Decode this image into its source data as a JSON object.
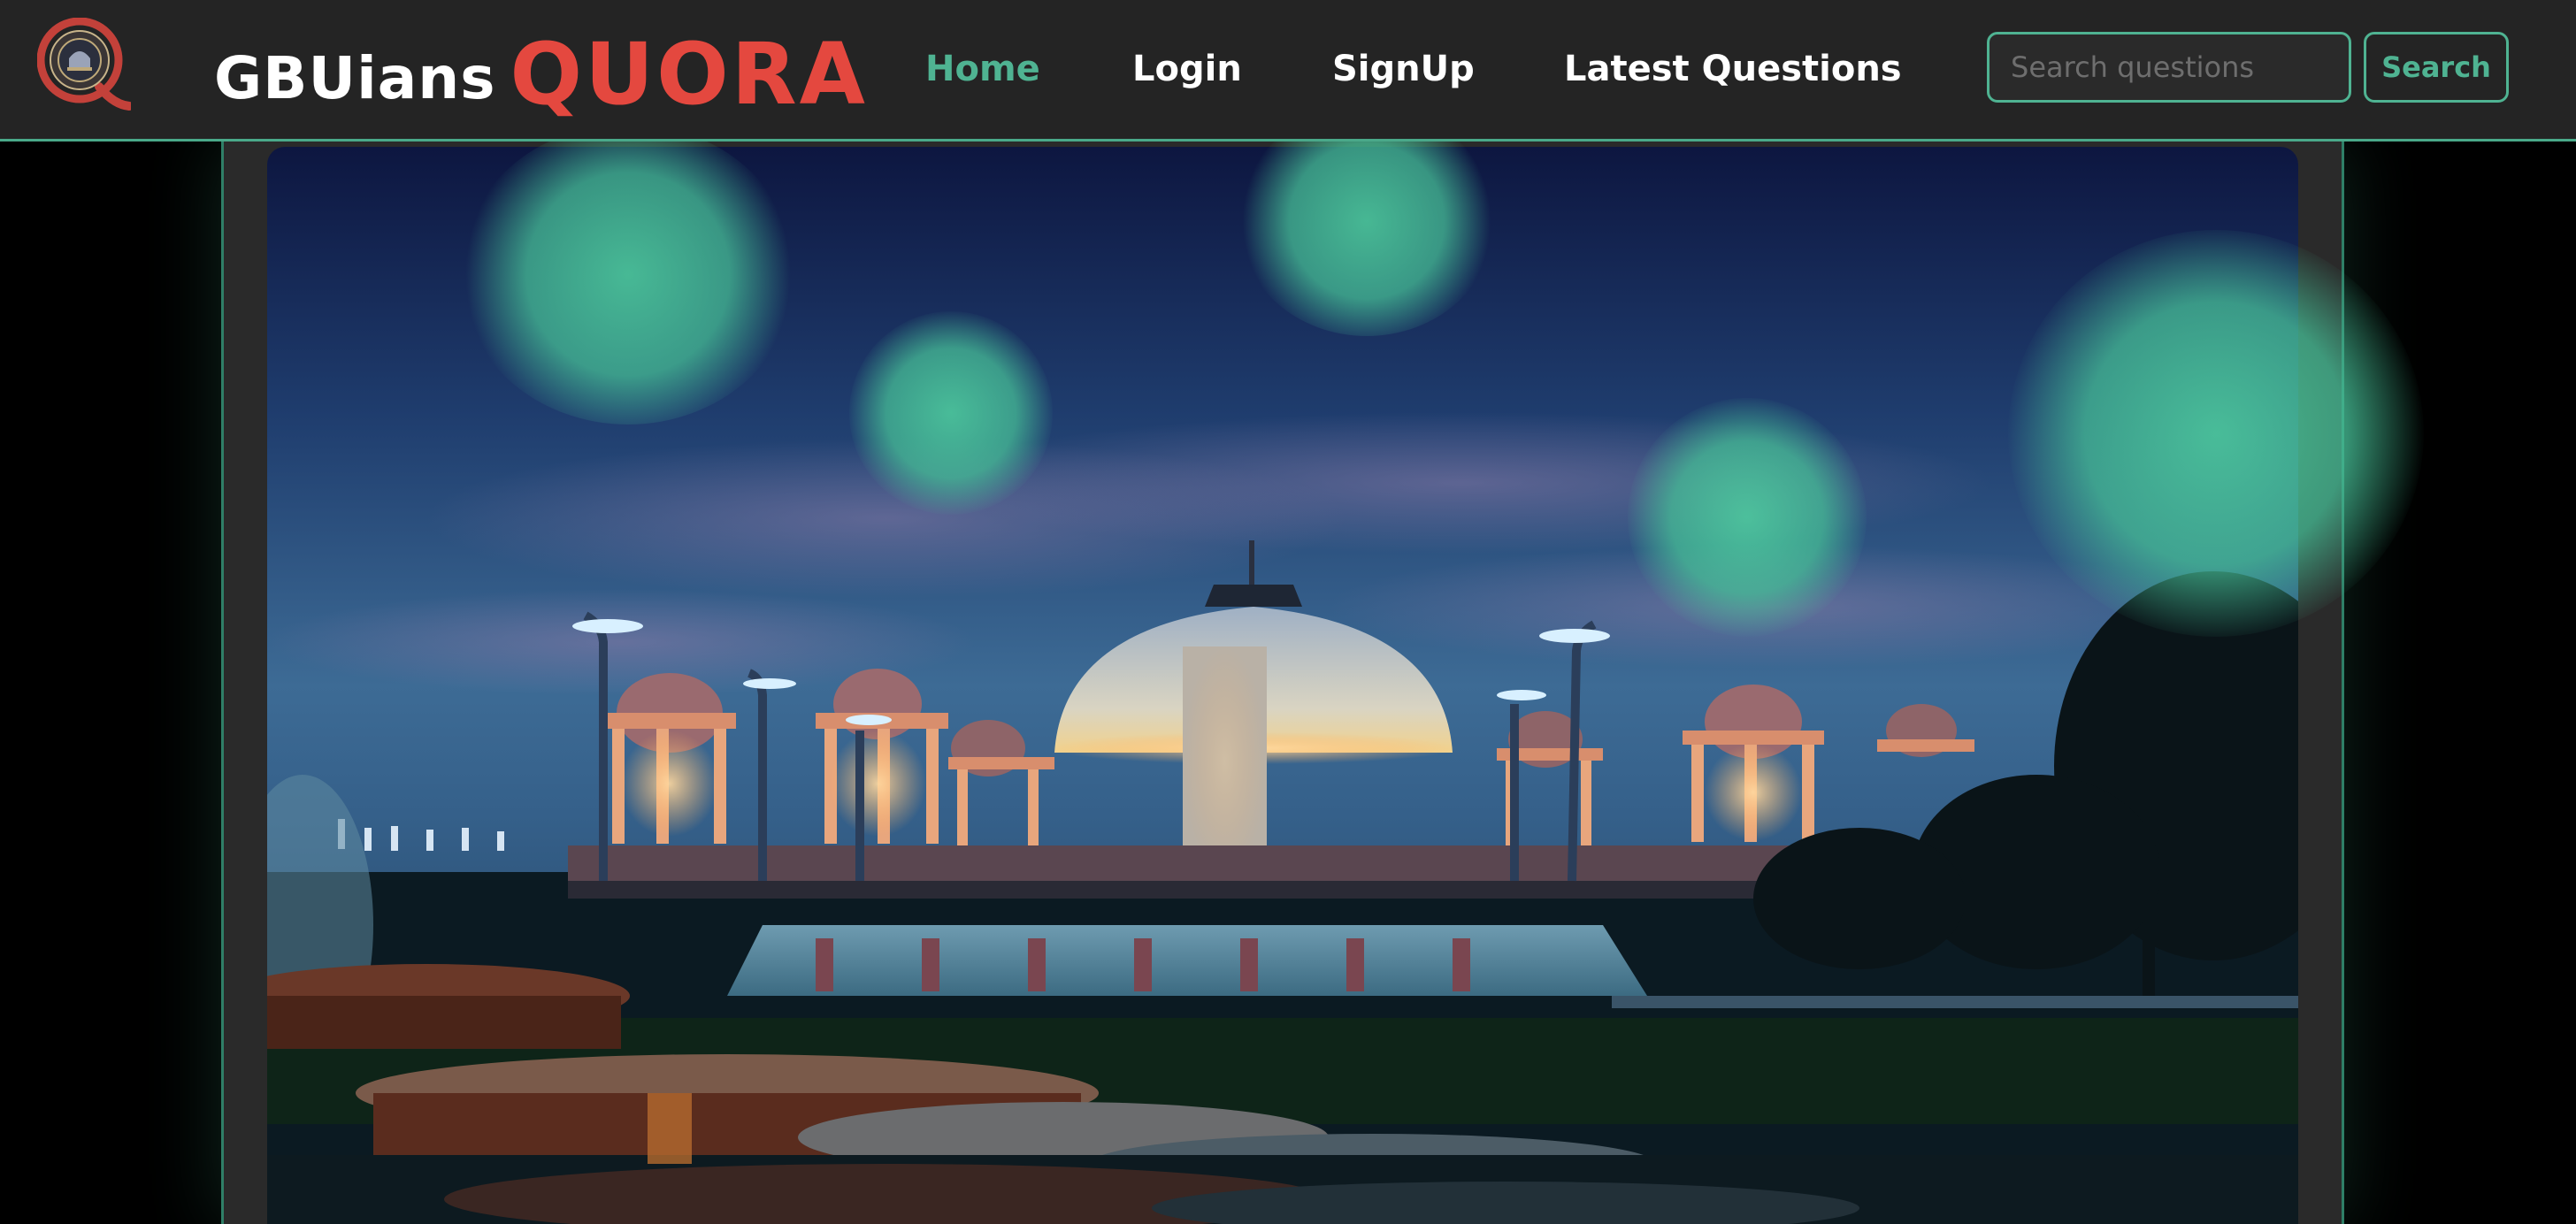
{
  "brand": {
    "name_part1": "GBUians",
    "name_part2": "QUORA"
  },
  "nav": {
    "home": "Home",
    "login": "Login",
    "signup": "SignUp",
    "latest_questions": "Latest Questions",
    "active": "home"
  },
  "search": {
    "placeholder": "Search questions",
    "value": "",
    "button_label": "Search"
  },
  "icons": {
    "logo": "university-seal-q-logo"
  },
  "colors": {
    "accent": "#4fb392",
    "brand_red": "#e4483f",
    "navbar_bg": "#242424",
    "page_bg": "#000000"
  }
}
